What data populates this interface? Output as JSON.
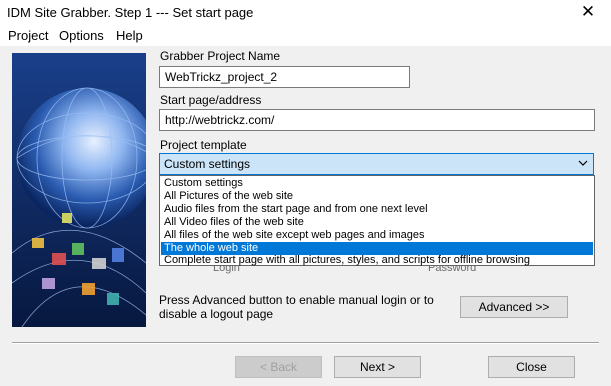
{
  "window": {
    "title": "IDM Site Grabber. Step 1 --- Set start page",
    "close_glyph": "✕"
  },
  "menu": {
    "items": [
      "Project",
      "Options",
      "Help"
    ]
  },
  "form": {
    "project_name_label": "Grabber Project Name",
    "project_name_value": "WebTrickz_project_2",
    "start_page_label": "Start page/address",
    "start_page_value": "http://webtrickz.com/",
    "template_label": "Project template",
    "template_selected": "Custom settings",
    "template_options": [
      "Custom settings",
      "All Pictures of the web site",
      "Audio files from the start page and from one next level",
      "All Video files of the web site",
      "All files of the web site except web pages and images",
      "The whole web site",
      "Complete start page with all pictures, styles, and scripts for offline browsing"
    ],
    "highlighted_option_index": 5,
    "login_label_partial": "Login",
    "password_label_partial": "Password",
    "advanced_note": "Press Advanced button to enable manual login or to disable a logout page",
    "advanced_button": "Advanced >>"
  },
  "buttons": {
    "back": "< Back",
    "next": "Next >",
    "close": "Close"
  },
  "colors": {
    "accent": "#0078d7",
    "combo_bg": "#cce4f7",
    "banner_bg": "#0a2560"
  },
  "icons": {
    "dropdown": "chevron-down-icon",
    "close": "close-icon"
  }
}
